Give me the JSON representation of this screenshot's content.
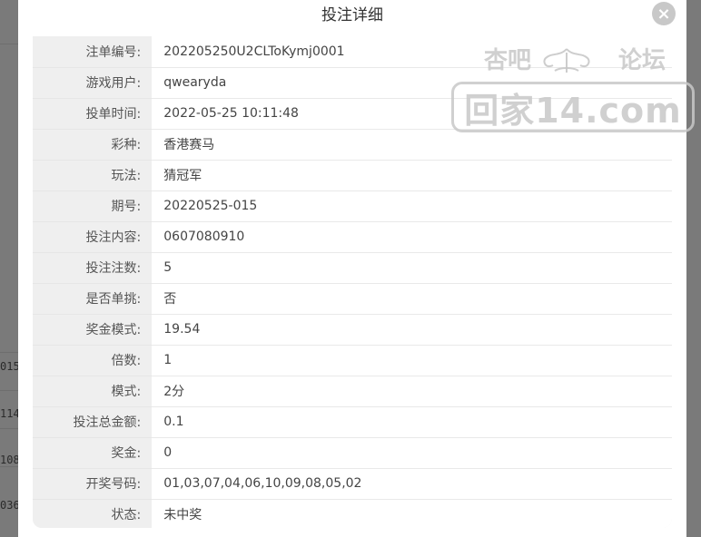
{
  "dialog": {
    "title": "投注详细",
    "close_label": "×"
  },
  "details": [
    {
      "label": "注单编号:",
      "value": "202205250U2CLToKymj0001"
    },
    {
      "label": "游戏用户:",
      "value": "qwearyda"
    },
    {
      "label": "投单时间:",
      "value": "2022-05-25 10:11:48"
    },
    {
      "label": "彩种:",
      "value": "香港赛马"
    },
    {
      "label": "玩法:",
      "value": "猜冠军"
    },
    {
      "label": "期号:",
      "value": "20220525-015"
    },
    {
      "label": "投注内容:",
      "value": "0607080910"
    },
    {
      "label": "投注注数:",
      "value": "5"
    },
    {
      "label": "是否单挑:",
      "value": "否"
    },
    {
      "label": "奖金模式:",
      "value": "19.54"
    },
    {
      "label": "倍数:",
      "value": "1"
    },
    {
      "label": "模式:",
      "value": "2分"
    },
    {
      "label": "投注总金额:",
      "value": "0.1"
    },
    {
      "label": "奖金:",
      "value": "0"
    },
    {
      "label": "开奖号码:",
      "value": "01,03,07,04,06,10,09,08,05,02"
    },
    {
      "label": "状态:",
      "value": "未中奖"
    }
  ],
  "watermark": {
    "top_left": "杏吧",
    "top_right": "论坛",
    "main": "回家14.com"
  },
  "background": {
    "fragments": [
      "015",
      "114",
      "108",
      "036"
    ]
  },
  "colors": {
    "overlay": "#7f7f7f",
    "label_bg": "#efefef",
    "value_bg": "#ffffff",
    "close_bg": "#c8c8c8"
  }
}
